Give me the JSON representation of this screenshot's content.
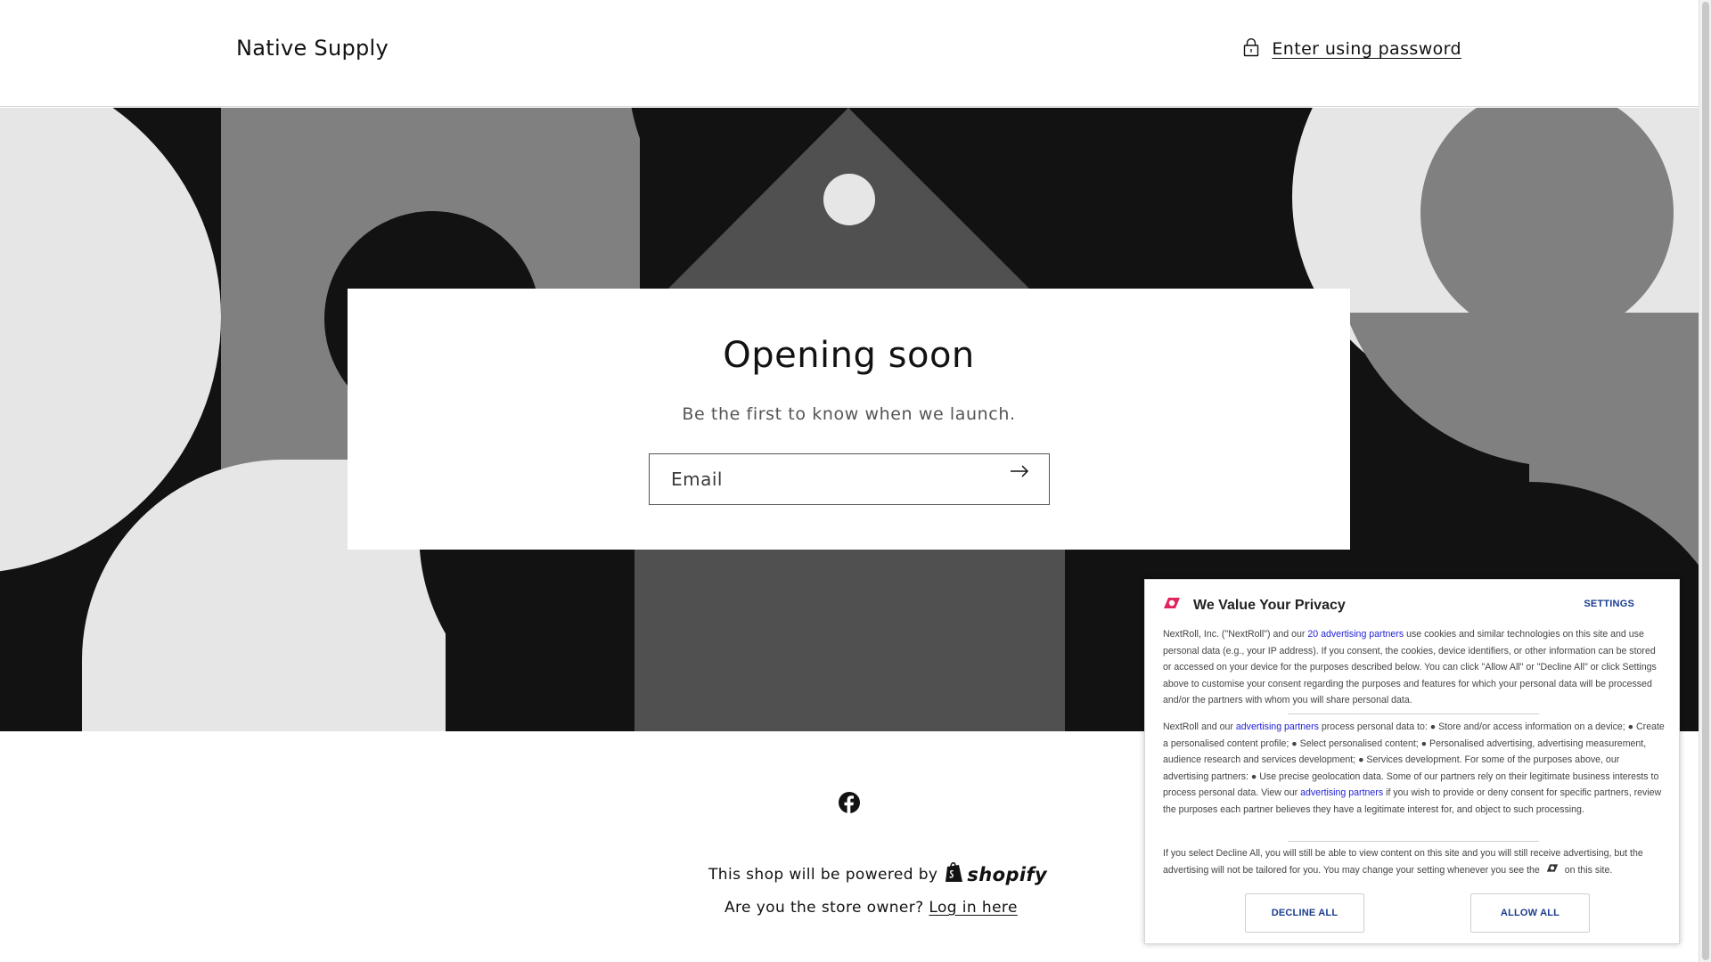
{
  "header": {
    "brand": "Native Supply",
    "password_link": "Enter using password"
  },
  "hero": {
    "title": "Opening soon",
    "subtitle": "Be the first to know when we launch.",
    "email_placeholder": "Email"
  },
  "footer": {
    "powered_text": "This shop will be powered by",
    "shopify_label": "shopify",
    "owner_prefix": "Are you the store owner?",
    "login_link": "Log in here"
  },
  "privacy": {
    "title": "We Value Your Privacy",
    "settings": "SETTINGS",
    "p1_before": "NextRoll, Inc. (\"NextRoll\") and our ",
    "p1_link": "20 advertising partners",
    "p1_after": " use cookies and similar technologies on this site and use personal data (e.g., your IP address). If you consent, the cookies, device identifiers, or other information can be stored or accessed on your device for the purposes described below. You can click \"Allow All\" or \"Decline All\" or click Settings above to customise your consent regarding the purposes and features for which your personal data will be processed and/or the partners with whom you will share personal data.",
    "p2_before": "NextRoll and our ",
    "p2_link1": "advertising partners",
    "p2_middle": " process personal data to: ● Store and/or access information on a device; ● Create a personalised content profile; ● Select personalised content; ● Personalised advertising, advertising measurement, audience research and services development; ● Services development. For some of the purposes above, our advertising partners: ● Use precise geolocation data. Some of our partners rely on their legitimate business interests to process personal data. View our ",
    "p2_link2": "advertising partners",
    "p2_after": " if you wish to provide or deny consent for specific partners, review the purposes each partner believes they have a legitimate interest for, and object to such processing.",
    "p3_before": "If you select Decline All, you will still be able to view content on this site and you will still receive advertising, but the advertising will not be tailored for you. You may change your setting whenever you see the",
    "p3_after": "on this site.",
    "decline": "DECLINE ALL",
    "allow": "ALLOW ALL"
  },
  "icons": {
    "lock": "lock-icon",
    "arrow": "arrow-right-icon",
    "facebook": "facebook-icon",
    "shopify_bag": "shopify-bag-icon",
    "nextroll": "nextroll-logo-icon"
  },
  "colors": {
    "hero_black": "#121212",
    "hero_gray": "#808080",
    "hero_dark_gray": "#505050",
    "hero_light": "#e6e6e6",
    "link_blue": "#1f1fd6",
    "brand_red": "#e0245e"
  }
}
